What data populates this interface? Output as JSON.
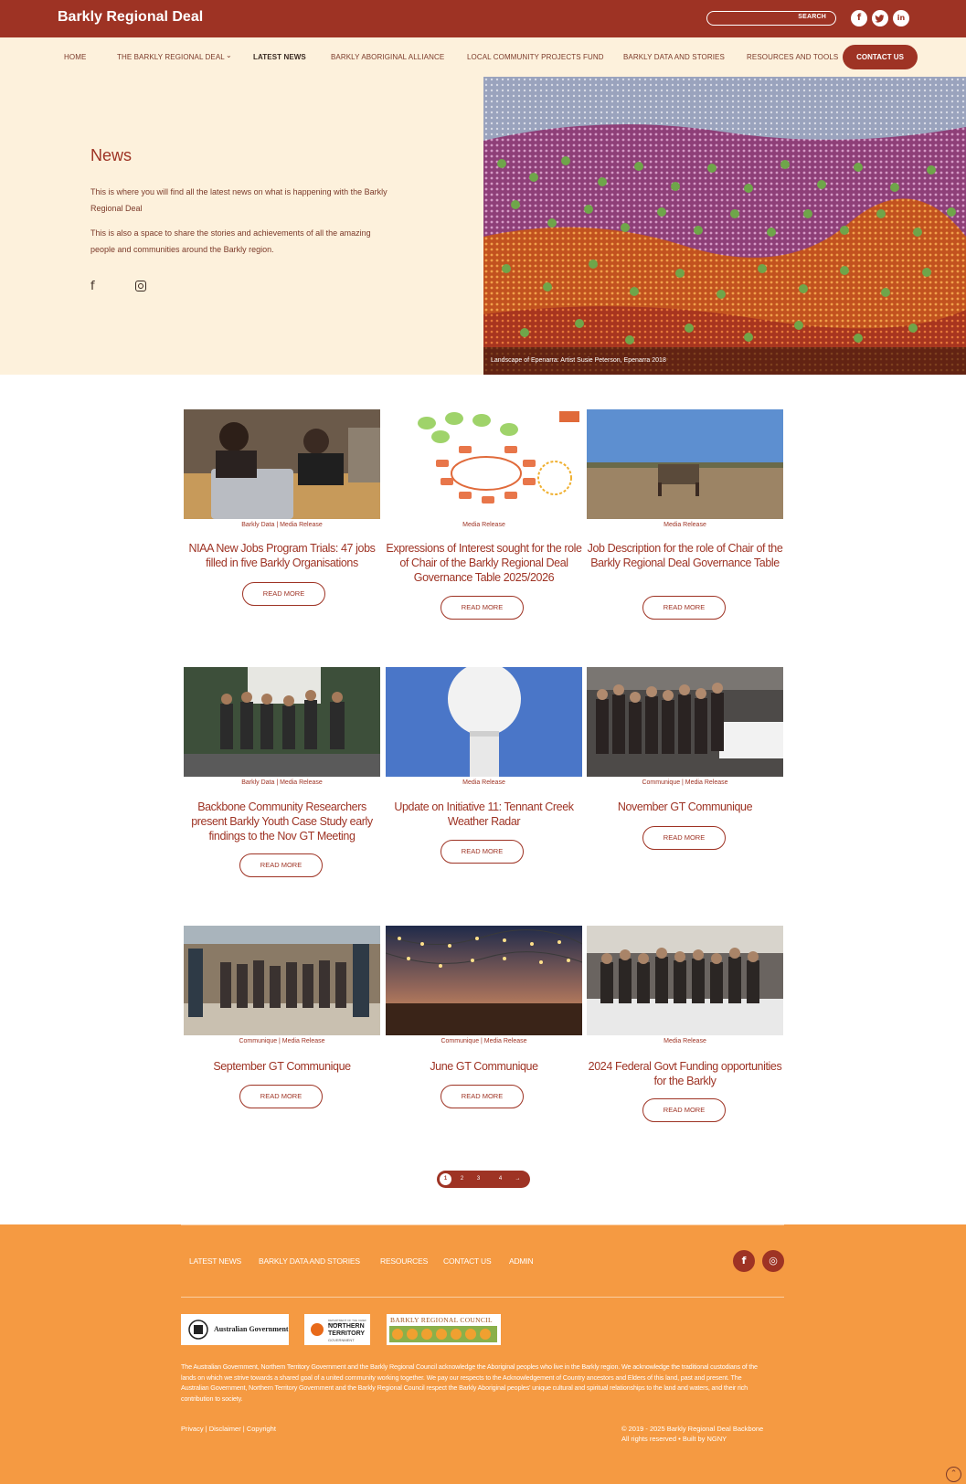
{
  "header": {
    "brand": "Barkly Regional Deal",
    "search_button": "SEARCH",
    "social": [
      {
        "icon": "facebook-icon",
        "glyph": "f"
      },
      {
        "icon": "twitter-icon",
        "glyph": "t"
      },
      {
        "icon": "linkedin-icon",
        "glyph": "in"
      }
    ]
  },
  "nav": {
    "items": [
      "HOME",
      "THE BARKLY REGIONAL DEAL",
      "LATEST NEWS",
      "BARKLY ABORIGINAL ALLIANCE",
      "LOCAL COMMUNITY PROJECTS FUND",
      "BARKLY DATA AND STORIES",
      "RESOURCES AND TOOLS"
    ],
    "active": "LATEST NEWS",
    "contact": "CONTACT US"
  },
  "hero": {
    "title": "News",
    "paragraph1": "This is where you will find all the latest news on what is happening with the Barkly Regional Deal",
    "paragraph2": "This is also a space to share the stories and achievements of all the amazing people and communities around the Barkly region.",
    "caption": "Landscape of Epenarra: Artist Susie Peterson, Epenarra 2018"
  },
  "posts": [
    {
      "category": "Barkly Data | Media Release",
      "title": "NIAA New Jobs Program Trials: 47 jobs filled in five Barkly Organisations",
      "button": "READ MORE"
    },
    {
      "category": "Media Release",
      "title": "Expressions of Interest sought for the role of Chair of the Barkly Regional Deal Governance Table 2025/2026",
      "button": "READ MORE"
    },
    {
      "category": "Media Release",
      "title": "Job Description for the role of Chair of the Barkly Regional Deal Governance Table",
      "button": "READ MORE"
    },
    {
      "category": "Barkly Data | Media Release",
      "title": "Backbone Community Researchers present Barkly Youth Case Study early findings to the Nov GT Meeting",
      "button": "READ MORE"
    },
    {
      "category": "Media Release",
      "title": "Update on Initiative 11: Tennant Creek Weather Radar",
      "button": "READ MORE"
    },
    {
      "category": "Communique | Media Release",
      "title": "November GT Communique",
      "button": "READ MORE"
    },
    {
      "category": "Communique | Media Release",
      "title": "September GT Communique",
      "button": "READ MORE"
    },
    {
      "category": "Communique | Media Release",
      "title": "June GT Communique",
      "button": "READ MORE"
    },
    {
      "category": "Media Release",
      "title": "2024 Federal Govt Funding opportunities for the Barkly",
      "button": "READ MORE"
    }
  ],
  "pagination": {
    "pages": [
      "1",
      "2",
      "3",
      "4"
    ],
    "next": "→",
    "current": "1"
  },
  "footer": {
    "links": [
      "LATEST NEWS",
      "BARKLY DATA AND STORIES",
      "RESOURCES",
      "CONTACT US",
      "ADMIN"
    ],
    "social": [
      {
        "icon": "facebook-icon",
        "glyph": "f"
      },
      {
        "icon": "instagram-icon",
        "glyph": "◎"
      }
    ],
    "logos": {
      "aus_gov": "Australian Government",
      "nt_small": "DEPARTMENT OF THE CHIEF MINISTER",
      "nt_name1": "NORTHERN",
      "nt_name2": "TERRITORY",
      "nt_gov": "GOVERNMENT",
      "barkly_council": "BARKLY REGIONAL COUNCIL"
    },
    "acknowledgement": "The Australian Government, Northern Territory Government and the Barkly Regional Council acknowledge the Aboriginal peoples who live in the Barkly region. We acknowledge the traditional custodians of the lands on which we strive towards a shared goal of a united community working together. We pay our respects to the Acknowledgement of Country ancestors and Elders of this land, past and present. The Australian Government, Northern Territory Government and the Barkly Regional Council respect the Barkly Aboriginal peoples' unique cultural and spiritual relationships to the land and waters, and their rich contribution to society.",
    "legal": "Privacy | Disclaimer | Copyright",
    "copyright1": "© 2019 - 2025 Barkly Regional Deal Backbone",
    "copyright2": "All rights reserved • Built by NGNY"
  },
  "colors": {
    "primary": "#9e3324",
    "cream": "#fdf1dc",
    "footer": "#f59a42"
  }
}
